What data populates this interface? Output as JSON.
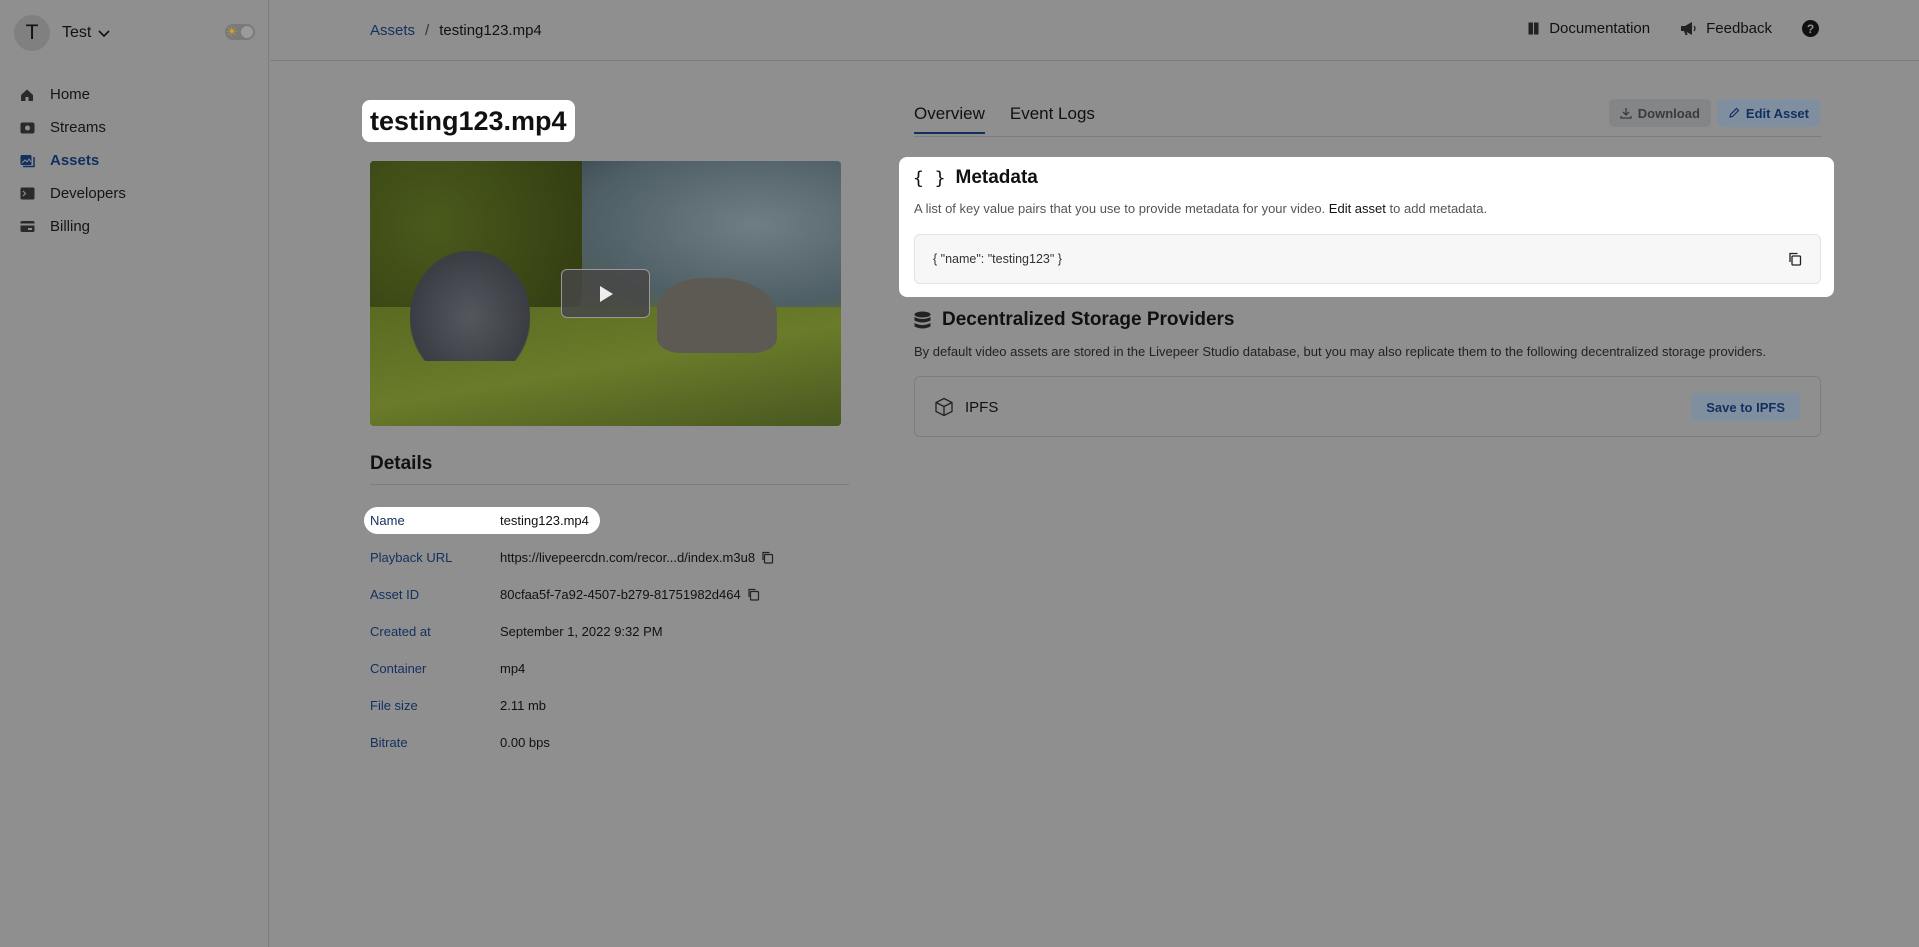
{
  "account": {
    "initial": "T",
    "name": "Test"
  },
  "sidebar": {
    "items": [
      {
        "label": "Home",
        "icon": "home-icon"
      },
      {
        "label": "Streams",
        "icon": "streams-icon"
      },
      {
        "label": "Assets",
        "icon": "assets-icon",
        "active": true
      },
      {
        "label": "Developers",
        "icon": "terminal-icon"
      },
      {
        "label": "Billing",
        "icon": "billing-icon"
      }
    ]
  },
  "breadcrumb": {
    "parent": "Assets",
    "separator": "/",
    "current": "testing123.mp4"
  },
  "topnav": {
    "documentation": "Documentation",
    "feedback": "Feedback",
    "help": "?"
  },
  "asset": {
    "title": "testing123.mp4"
  },
  "details": {
    "heading": "Details",
    "rows": [
      {
        "label": "Name",
        "value": "testing123.mp4"
      },
      {
        "label": "Playback URL",
        "value": "https://livepeercdn.com/recor...d/index.m3u8"
      },
      {
        "label": "Asset ID",
        "value": "80cfaa5f-7a92-4507-b279-81751982d464"
      },
      {
        "label": "Created at",
        "value": "September 1, 2022 9:32 PM"
      },
      {
        "label": "Container",
        "value": "mp4"
      },
      {
        "label": "File size",
        "value": "2.11 mb"
      },
      {
        "label": "Bitrate",
        "value": "0.00 bps"
      }
    ]
  },
  "tabs": [
    {
      "label": "Overview",
      "active": true
    },
    {
      "label": "Event Logs"
    }
  ],
  "actions": {
    "download": "Download",
    "edit": "Edit Asset"
  },
  "metadata": {
    "heading": "Metadata",
    "icon": "{ }",
    "desc_pre": "A list of key value pairs that you use to provide metadata for your video.",
    "desc_link": "Edit asset",
    "desc_post": "to add metadata.",
    "code": "{ \"name\": \"testing123\" }"
  },
  "storage": {
    "heading": "Decentralized Storage Providers",
    "desc": "By default video assets are stored in the Livepeer Studio database, but you may also replicate them to the following decentralized storage providers.",
    "provider": "IPFS",
    "save_label": "Save to IPFS"
  },
  "colors": {
    "accent": "#12305f",
    "overlay": "#8f8f8f"
  }
}
